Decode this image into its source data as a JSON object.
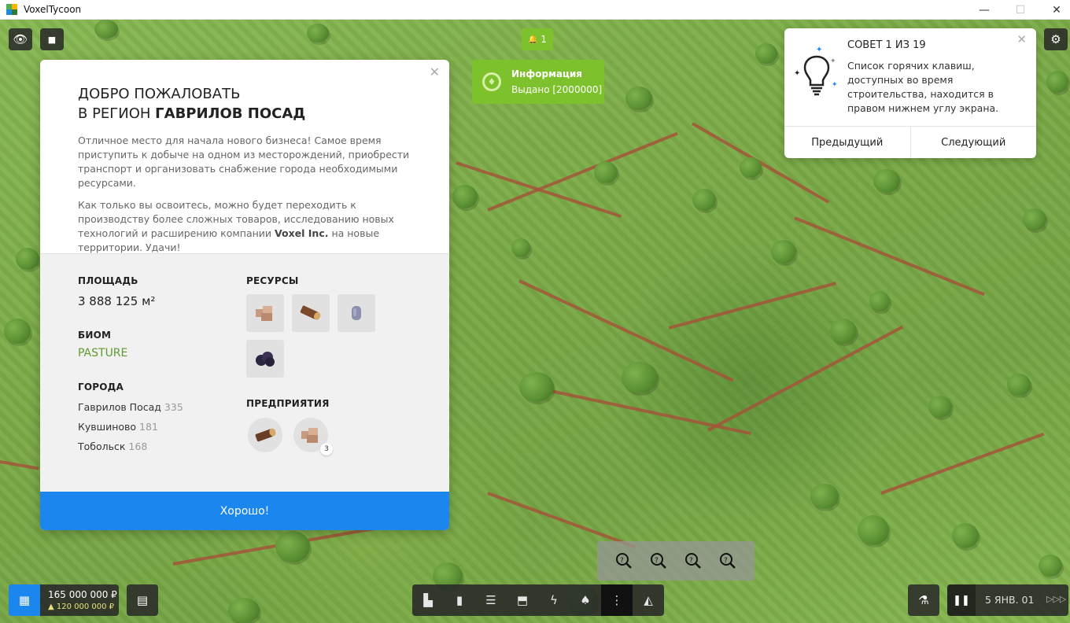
{
  "window": {
    "title": "VoxelTycoon",
    "min": "—",
    "max": "☐",
    "close": "✕"
  },
  "hud": {
    "eye_icon": "👁",
    "camera_icon": "■",
    "settings_icon": "⚙"
  },
  "notification": {
    "count": "1",
    "bell_icon": "🔔",
    "title": "Информация",
    "text": "Выдано [2000000]",
    "flame_icon": "♦"
  },
  "welcome": {
    "close": "✕",
    "title_line1": "ДОБРО ПОЖАЛОВАТЬ",
    "title_line2_prefix": "В РЕГИОН ",
    "title_line2_region": "ГАВРИЛОВ ПОСАД",
    "paragraph1": "Отличное место для начала нового бизнеса! Самое время приступить к добыче на одном из месторождений, приобрести транспорт и организовать снабжение города необходимыми ресурсами.",
    "paragraph2_a": "Как только вы освоитесь, можно будет переходить к производству более сложных товаров, исследованию новых технологий и расширению компании ",
    "paragraph2_company": "Voxel Inc.",
    "paragraph2_b": " на новые территории. Удачи!",
    "area_label": "ПЛОЩАДЬ",
    "area_value": "3 888 125 м²",
    "biome_label": "БИОМ",
    "biome_value": "PASTURE",
    "cities_label": "ГОРОДА",
    "cities": [
      {
        "name": "Гаврилов Посад",
        "population": "335"
      },
      {
        "name": "Кувшиново",
        "population": "181"
      },
      {
        "name": "Тобольск",
        "population": "168"
      }
    ],
    "resources_label": "РЕСУРСЫ",
    "resources": [
      "stone-resource-icon",
      "wood-log-resource-icon",
      "iron-ore-resource-icon",
      "coal-resource-icon"
    ],
    "enterprises_label": "ПРЕДПРИЯТИЯ",
    "enterprises": [
      {
        "icon": "wood-log-enterprise-icon",
        "count": ""
      },
      {
        "icon": "stone-enterprise-icon",
        "count": "3"
      }
    ],
    "ok_label": "Хорошо!"
  },
  "tip": {
    "close": "✕",
    "header": "СОВЕТ 1 ИЗ 19",
    "text": "Список горячих клавиш, доступных во время строительства, находится в правом нижнем углу экрана.",
    "prev_label": "Предыдущий",
    "next_label": "Следующий"
  },
  "zoom": {
    "icons": [
      "zoom-hint-icon-1",
      "zoom-hint-icon-2",
      "zoom-hint-icon-3",
      "zoom-hint-icon-4"
    ]
  },
  "money": {
    "balance": "165 000 000 ₽",
    "credit": "▲ 120 000 000 ₽",
    "city_icon": "▦",
    "vehicles_icon": "▤"
  },
  "toolbar": {
    "items": [
      {
        "name": "factory",
        "glyph": "▙"
      },
      {
        "name": "station",
        "glyph": "▮"
      },
      {
        "name": "rail",
        "glyph": "☰"
      },
      {
        "name": "road",
        "glyph": "⬒"
      },
      {
        "name": "power",
        "glyph": "ϟ"
      },
      {
        "name": "tree",
        "glyph": "♠"
      },
      {
        "name": "more",
        "glyph": "⋮"
      },
      {
        "name": "bulldozer",
        "glyph": "◭"
      }
    ]
  },
  "research_icon": "⚗",
  "time": {
    "pause": "❚❚",
    "date": "5 ЯНВ. 01",
    "speed": "▷▷▷"
  },
  "colors": {
    "accent": "#1a86ee",
    "notify_green": "#7dc22c",
    "biome_green": "#5e9b2e"
  }
}
